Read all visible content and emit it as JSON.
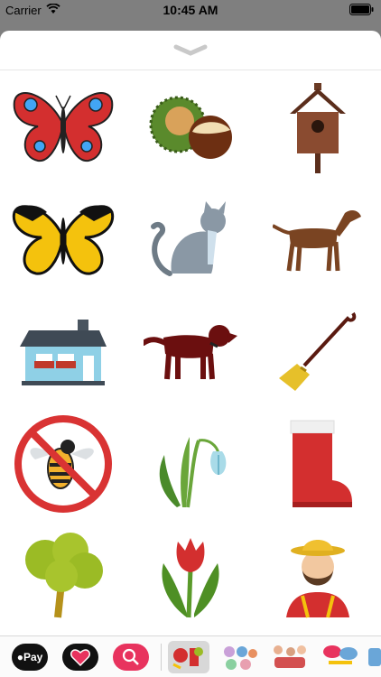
{
  "status_bar": {
    "carrier": "Carrier",
    "time": "10:45 AM"
  },
  "sheet": {
    "grabber_icon": "chevron-down-icon"
  },
  "stickers": [
    {
      "name": "peacock-butterfly",
      "icon": "butterfly-red-icon"
    },
    {
      "name": "chestnut",
      "icon": "chestnut-icon"
    },
    {
      "name": "birdhouse",
      "icon": "birdhouse-icon"
    },
    {
      "name": "yellow-butterfly",
      "icon": "butterfly-yellow-icon"
    },
    {
      "name": "gray-cat",
      "icon": "cat-icon"
    },
    {
      "name": "brown-dog",
      "icon": "dog-brown-icon"
    },
    {
      "name": "house",
      "icon": "house-icon"
    },
    {
      "name": "setter-dog",
      "icon": "dog-setter-icon"
    },
    {
      "name": "broom",
      "icon": "broom-icon"
    },
    {
      "name": "no-wasp-sign",
      "icon": "no-wasp-icon"
    },
    {
      "name": "snowdrop",
      "icon": "snowdrop-icon"
    },
    {
      "name": "rubber-boot",
      "icon": "boot-icon"
    },
    {
      "name": "tree",
      "icon": "tree-icon"
    },
    {
      "name": "tulip",
      "icon": "tulip-icon"
    },
    {
      "name": "farmer",
      "icon": "farmer-icon"
    }
  ],
  "app_drawer": {
    "apple_pay_label": " Pay",
    "items": [
      "apple-pay",
      "heart-app",
      "image-search-app",
      "country-stickers",
      "owl-stickers",
      "people-stickers",
      "speech-stickers"
    ]
  },
  "colors": {
    "sheet_bg": "#ffffff",
    "dim_bg": "#7f7f7f",
    "search_app": "#e8335e"
  }
}
